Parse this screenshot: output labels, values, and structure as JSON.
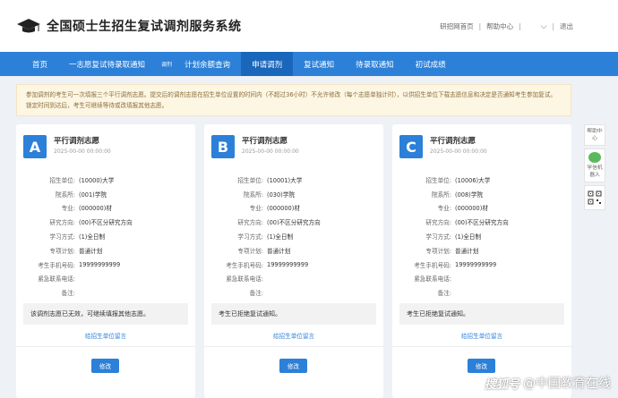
{
  "header": {
    "title": "全国硕士生招生复试调剂服务系统",
    "links": [
      "研招网首页",
      "帮助中心",
      "退出"
    ]
  },
  "nav": {
    "items": [
      {
        "label": "首页",
        "small": false,
        "active": false
      },
      {
        "label": "一志愿复试待录取通知",
        "small": false,
        "active": false
      },
      {
        "label": "调剂",
        "small": true,
        "active": false
      },
      {
        "label": "计划余额查询",
        "small": false,
        "active": false
      },
      {
        "label": "申请调剂",
        "small": false,
        "active": true
      },
      {
        "label": "复试通知",
        "small": false,
        "active": false
      },
      {
        "label": "待录取通知",
        "small": false,
        "active": false
      },
      {
        "label": "初试成绩",
        "small": false,
        "active": false
      }
    ]
  },
  "notice": "参加调剂的考生可一次填报三个平行调剂志愿。提交后的调剂志愿在招生单位设置的时间内（不超过36小时）不允许修改（每个志愿单独计时），以供招生单位下载志愿信息和决定是否通知考生参加复试。锁定时间到达后，考生可继续等待或改填报其他志愿。",
  "field_labels": [
    "招生单位:",
    "院系所:",
    "专业:",
    "研究方向:",
    "学习方式:",
    "专项计划:",
    "考生手机号码:",
    "紧急联系电话:",
    "备注:"
  ],
  "cards": [
    {
      "letter": "A",
      "title": "平行调剂志愿",
      "date": "2025-00-00 00:00:00",
      "values": [
        "(10000)大学",
        "(001)学院",
        "(000000)材",
        "(00)不区分研究方向",
        "(1)全日制",
        "普通计划",
        "19999999999",
        "",
        ""
      ],
      "message": "该调剂志愿已无效，可继续填报其他志愿。",
      "link": "给招生单位留言",
      "button": "修改"
    },
    {
      "letter": "B",
      "title": "平行调剂志愿",
      "date": "2025-00-00 00:00:00",
      "values": [
        "(10001)大学",
        "(030)学院",
        "(000000)材",
        "(00)不区分研究方向",
        "(1)全日制",
        "普通计划",
        "19999999999",
        "",
        ""
      ],
      "message": "考生已拒绝复试通知。",
      "link": "给招生单位留言",
      "button": "修改"
    },
    {
      "letter": "C",
      "title": "平行调剂志愿",
      "date": "2025-00-00 00:00:00",
      "values": [
        "(10006)大学",
        "(008)学院",
        "(000000)材",
        "(00)不区分研究方向",
        "(1)全日制",
        "普通计划",
        "19999999999",
        "",
        ""
      ],
      "message": "考生已拒绝复试通知。",
      "link": "给招生单位留言",
      "button": "修改"
    }
  ],
  "side": {
    "help": "帮助中心",
    "robot": "学信机器人"
  },
  "watermark": {
    "brand": "搜狐号",
    "text": "@中国教育在线"
  },
  "colors": {
    "primary": "#2c80d8",
    "nav_active": "#1a66bb",
    "notice_bg": "#fdf6e3",
    "notice_text": "#8a6d3b"
  }
}
